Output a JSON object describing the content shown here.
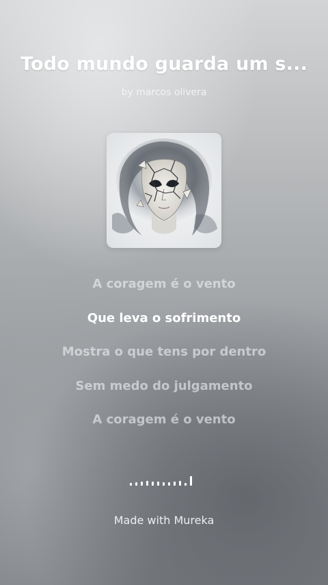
{
  "song": {
    "title": "Todo mundo guarda um s...",
    "author": "by marcos olivera"
  },
  "cover": {
    "icon": "cracked-mask-artwork"
  },
  "lyrics": [
    {
      "text": "A coragem é o vento",
      "active": false
    },
    {
      "text": "Que leva o sofrimento",
      "active": true
    },
    {
      "text": "Mostra o que tens por dentro",
      "active": false
    },
    {
      "text": "Sem medo do julgamento",
      "active": false
    },
    {
      "text": "A coragem é o vento",
      "active": false
    }
  ],
  "visualizer": {
    "icon": "audio-visualizer-icon",
    "levels": [
      0.25,
      0.3,
      0.35,
      0.45,
      0.4,
      0.35,
      0.3,
      0.3,
      0.35,
      0.45,
      0.25,
      0.9
    ]
  },
  "footer": {
    "label": "Made with Mureka"
  }
}
